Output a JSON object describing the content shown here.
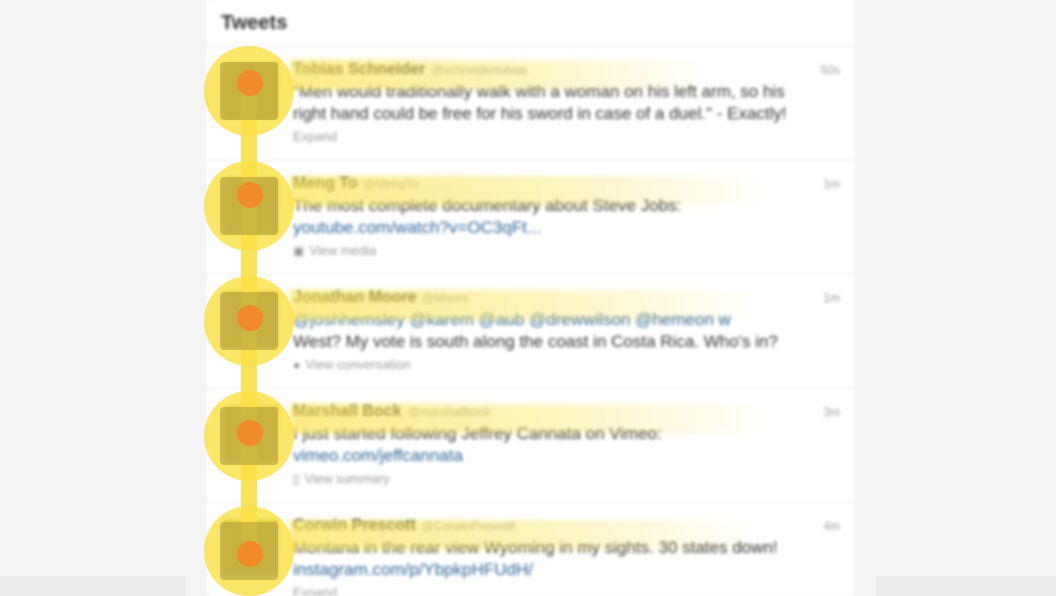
{
  "colors": {
    "highlight": "#f8e25a",
    "dot": "#f08a2a",
    "link": "#2a6496"
  },
  "header": {
    "title": "Tweets"
  },
  "tweets": [
    {
      "name": "Tobias Schneider",
      "handle": "@schneidertobias",
      "time": "50s",
      "text_lines": [
        "\"Men would traditionally walk with a woman on his left arm, so his",
        "right hand could be free for his sword in case of a duel.\" - Exactly!"
      ],
      "action": "Expand",
      "action_icon": "",
      "avatar_color": "#b59a44"
    },
    {
      "name": "Meng To",
      "handle": "@MengTo",
      "time": "1m",
      "text_lines": [
        "The most complete documentary about Steve Jobs:",
        "youtube.com/watch?v=OC3qFt..."
      ],
      "action": "View media",
      "action_icon": "media-icon",
      "avatar_color": "#a58f4a"
    },
    {
      "name": "Jonathan Moore",
      "handle": "@Moore",
      "time": "1m",
      "text_lines": [
        "@joshhemsley @karem @aub @drewwilson @hemeon w",
        "West? My vote is south along the coast in Costa Rica. Who's in?"
      ],
      "action": "View conversation",
      "action_icon": "conversation-icon",
      "avatar_color": "#9c8e5c"
    },
    {
      "name": "Marshall Bock",
      "handle": "@marshallbock",
      "time": "3m",
      "text_lines": [
        "I just started following Jeffrey Cannata on Vimeo:",
        "vimeo.com/jeffcannata"
      ],
      "action": "View summary",
      "action_icon": "summary-icon",
      "avatar_color": "#b8a656"
    },
    {
      "name": "Corwin Prescott",
      "handle": "@CorwinPrescott",
      "time": "4m",
      "text_lines": [
        "Montana in the rear view Wyoming in my sights.  30 states down!",
        "instagram.com/p/YbpkpHFUdH/"
      ],
      "action": "Expand",
      "action_icon": "",
      "avatar_color": "#8f9a4a"
    }
  ]
}
